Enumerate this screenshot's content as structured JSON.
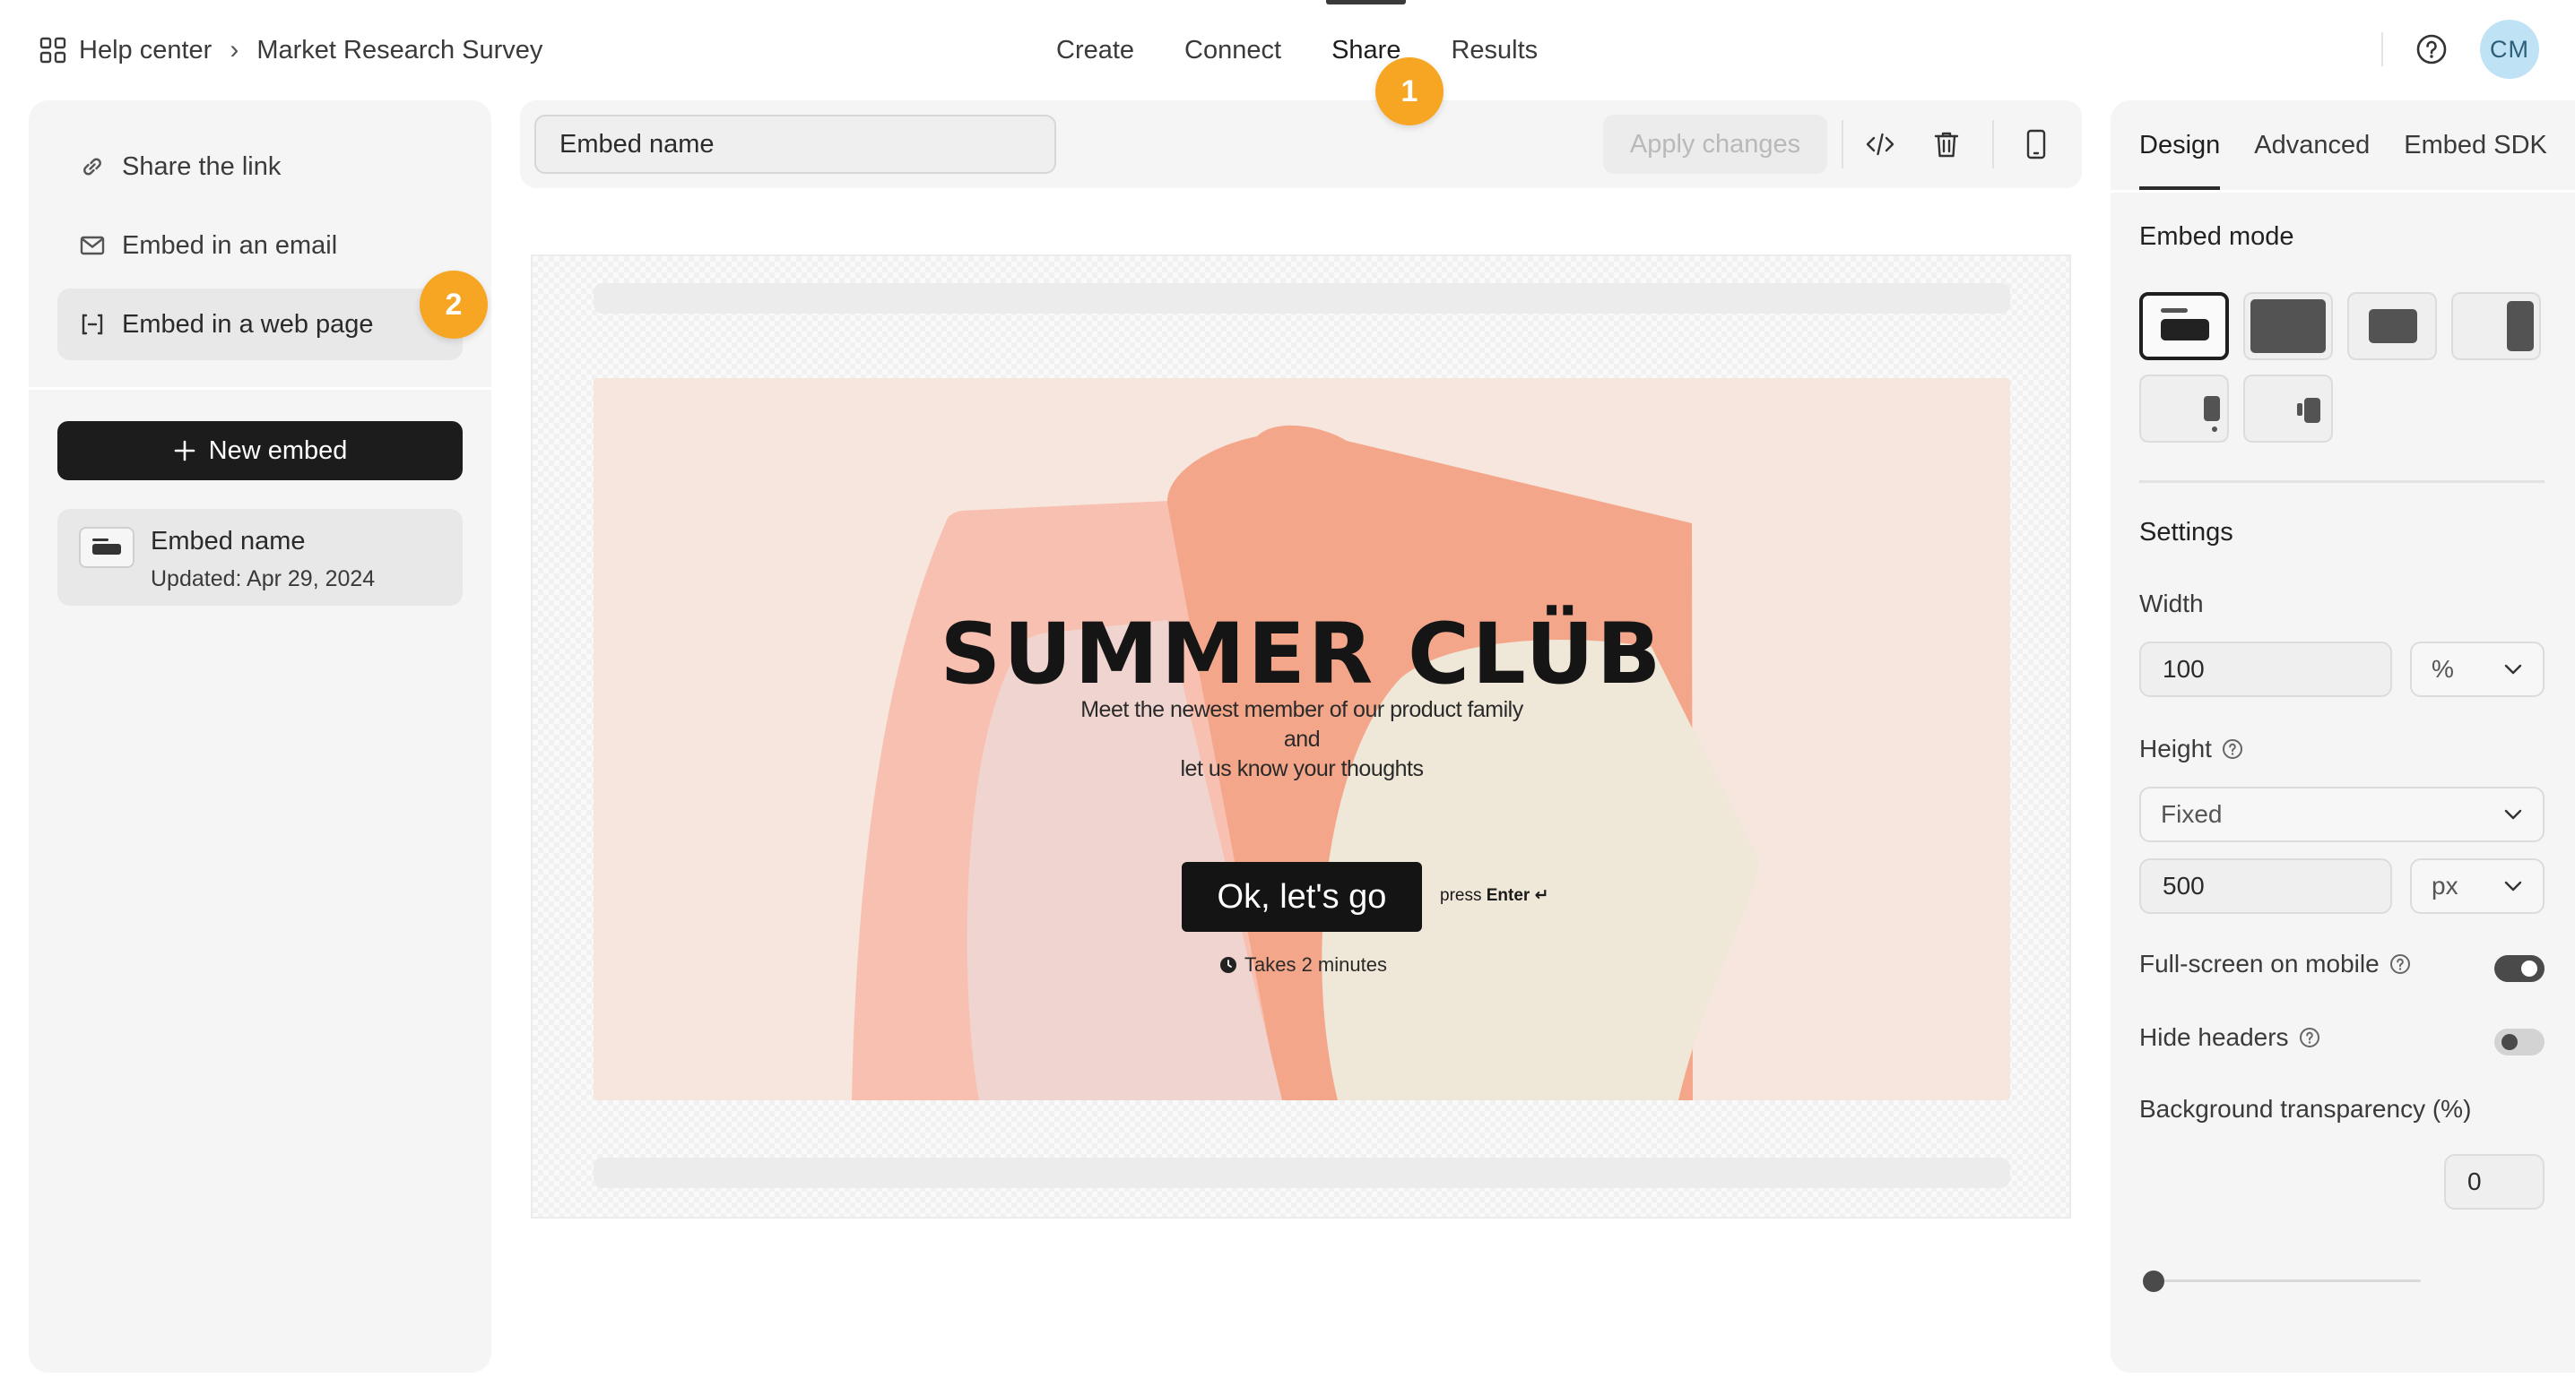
{
  "breadcrumb": {
    "root": "Help center",
    "separator": "›",
    "current": "Market Research Survey"
  },
  "nav": {
    "tabs": [
      "Create",
      "Connect",
      "Share",
      "Results"
    ],
    "active": "Share"
  },
  "user": {
    "initials": "CM"
  },
  "callouts": {
    "first": "1",
    "second": "2"
  },
  "share_options": [
    {
      "label": "Share the link",
      "icon": "link-icon"
    },
    {
      "label": "Embed in an email",
      "icon": "mail-icon"
    },
    {
      "label": "Embed in a web page",
      "icon": "embed-code-icon",
      "active": true
    }
  ],
  "new_embed_button": "New embed",
  "embeds": [
    {
      "name": "Embed name",
      "updated": "Updated: Apr 29, 2024"
    }
  ],
  "toolbar": {
    "name_value": "Embed name",
    "apply_label": "Apply changes",
    "icons": [
      "code-icon",
      "trash-icon",
      "mobile-preview-icon"
    ]
  },
  "preview": {
    "title": "SUMMER CLÜB",
    "subtitle_line1": "Meet the newest member of our product family and",
    "subtitle_line2": "let us know your thoughts",
    "button": "Ok, let's go",
    "press": "press",
    "press_key": "Enter ↵",
    "duration": "Takes 2 minutes",
    "colors": {
      "background": "#f6e6dd",
      "salmon": "#f4a68a",
      "pink": "#f8c0b0",
      "light_pink": "#f0d4cf",
      "cream": "#efe7d8"
    }
  },
  "design_panel": {
    "tabs": [
      "Design",
      "Advanced",
      "Embed SDK"
    ],
    "active_tab": "Design",
    "embed_mode_label": "Embed mode",
    "modes": [
      "standard",
      "full-page",
      "popup",
      "slider",
      "popover",
      "side-tab"
    ],
    "active_mode": "standard",
    "settings_label": "Settings",
    "width_label": "Width",
    "width_value": "100",
    "width_unit": "%",
    "height_label": "Height",
    "height_mode": "Fixed",
    "height_value": "500",
    "height_unit": "px",
    "fullscreen_mobile_label": "Full-screen on mobile",
    "fullscreen_mobile_on": true,
    "hide_headers_label": "Hide headers",
    "hide_headers_on": false,
    "bg_transparency_label": "Background transparency (%)",
    "bg_transparency_value": "0"
  }
}
